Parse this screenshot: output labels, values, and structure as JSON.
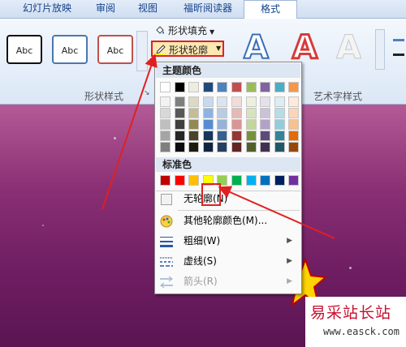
{
  "tabs": [
    "幻灯片放映",
    "审阅",
    "视图",
    "福昕阅读器",
    "格式"
  ],
  "ribbon": {
    "style_sample": "Abc",
    "shape_fill": "形状填充",
    "shape_outline": "形状轮廓",
    "group_shape_styles": "形状样式",
    "group_wordart": "艺术字样式",
    "wordart_letter": "A"
  },
  "dropdown": {
    "theme_header": "主题颜色",
    "standard_header": "标准色",
    "theme_top": [
      "#ffffff",
      "#000000",
      "#eeece1",
      "#1f497d",
      "#4f81bd",
      "#c0504d",
      "#9bbb59",
      "#8064a2",
      "#4bacc6",
      "#f79646"
    ],
    "theme_shades": [
      [
        "#f2f2f2",
        "#d8d8d8",
        "#bfbfbf",
        "#a5a5a5",
        "#7f7f7f"
      ],
      [
        "#7f7f7f",
        "#595959",
        "#3f3f3f",
        "#262626",
        "#0c0c0c"
      ],
      [
        "#ddd9c3",
        "#c4bd97",
        "#938953",
        "#494429",
        "#1d1b10"
      ],
      [
        "#c6d9f0",
        "#8db3e2",
        "#548dd4",
        "#17365d",
        "#0f243e"
      ],
      [
        "#dbe5f1",
        "#b8cce4",
        "#95b3d7",
        "#366092",
        "#244061"
      ],
      [
        "#f2dcdb",
        "#e5b9b7",
        "#d99694",
        "#953734",
        "#632423"
      ],
      [
        "#ebf1dd",
        "#d7e3bc",
        "#c3d69b",
        "#76923c",
        "#4f6128"
      ],
      [
        "#e5e0ec",
        "#ccc1d9",
        "#b2a2c7",
        "#5f497a",
        "#3f3151"
      ],
      [
        "#dbeef3",
        "#b7dde8",
        "#92cddc",
        "#31859b",
        "#205867"
      ],
      [
        "#fdeada",
        "#fbd5b5",
        "#fac08f",
        "#e36c09",
        "#974806"
      ]
    ],
    "standard": [
      "#c00000",
      "#ff0000",
      "#ffc000",
      "#ffff00",
      "#92d050",
      "#00b050",
      "#00b0f0",
      "#0070c0",
      "#002060",
      "#7030a0"
    ],
    "no_outline": "无轮廓(N)",
    "more_colors": "其他轮廓颜色(M)...",
    "weight": "粗细(W)",
    "dashes": "虚线(S)",
    "arrows": "箭头(R)"
  },
  "watermark": {
    "title": "易采站长站",
    "url": "www.easck.com"
  }
}
